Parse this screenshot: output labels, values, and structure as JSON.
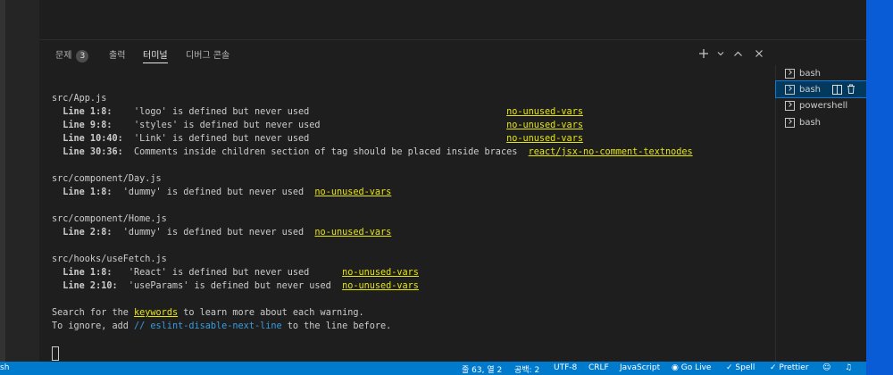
{
  "panel": {
    "tabs": [
      {
        "label": "문제",
        "badge": "3"
      },
      {
        "label": "출력"
      },
      {
        "label": "터미널",
        "active": true
      },
      {
        "label": "디버그 콘솔"
      }
    ],
    "actions": [
      "add-icon",
      "chevron-down-icon",
      "chevron-up-icon",
      "close-icon"
    ]
  },
  "terminal": {
    "lines": [
      {
        "text": "src/App.js"
      },
      {
        "loc": "  Line 1:8:   ",
        "msg": " 'logo' is defined but never used                                    ",
        "rule": "no-unused-vars"
      },
      {
        "loc": "  Line 9:8:   ",
        "msg": " 'styles' is defined but never used                                  ",
        "rule": "no-unused-vars"
      },
      {
        "loc": "  Line 10:40: ",
        "msg": " 'Link' is defined but never used                                    ",
        "rule": "no-unused-vars"
      },
      {
        "loc": "  Line 30:36: ",
        "msg": " Comments inside children section of tag should be placed inside braces  ",
        "rule": "react/jsx-no-comment-textnodes"
      },
      {
        "text": ""
      },
      {
        "text": "src/component/Day.js"
      },
      {
        "loc": "  Line 1:8: ",
        "msg": " 'dummy' is defined but never used  ",
        "rule": "no-unused-vars"
      },
      {
        "text": ""
      },
      {
        "text": "src/component/Home.js"
      },
      {
        "loc": "  Line 2:8: ",
        "msg": " 'dummy' is defined but never used  ",
        "rule": "no-unused-vars"
      },
      {
        "text": ""
      },
      {
        "text": "src/hooks/useFetch.js"
      },
      {
        "loc": "  Line 1:8:  ",
        "msg": " 'React' is defined but never used      ",
        "rule": "no-unused-vars"
      },
      {
        "loc": "  Line 2:10: ",
        "msg": " 'useParams' is defined but never used  ",
        "rule": "no-unused-vars"
      },
      {
        "text": ""
      },
      {
        "pre": "Search for the ",
        "kw": "keywords",
        "post": " to learn more about each warning."
      },
      {
        "pre": "To ignore, add ",
        "cm": "// eslint-disable-next-line",
        "post": " to the line before."
      }
    ]
  },
  "terminal_list": [
    {
      "label": "bash"
    },
    {
      "label": "bash",
      "selected": true
    },
    {
      "label": "powershell"
    },
    {
      "label": "bash"
    }
  ],
  "status": {
    "left": "sh",
    "position": "줄 63, 열 2",
    "spaces": "공백: 2",
    "encoding": "UTF-8",
    "eol": "CRLF",
    "language": "JavaScript",
    "golive": "Go Live",
    "spell": "Spell",
    "prettier": "Prettier"
  },
  "colors": {
    "statusbar": "#007acc",
    "rule": "#e5e510",
    "comment": "#3b9bdb",
    "selected": "#04395e"
  }
}
